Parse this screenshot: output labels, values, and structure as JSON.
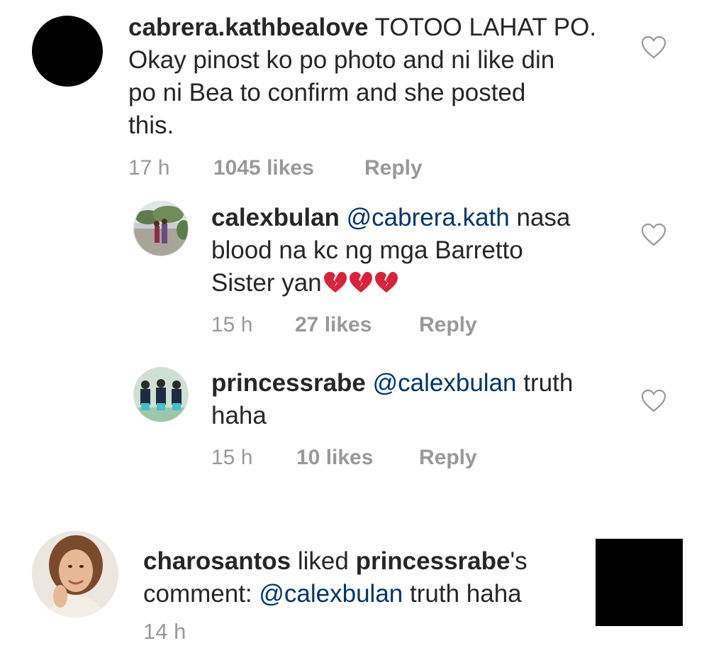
{
  "comments": [
    {
      "username": "cabrera.kathbealove",
      "lines": [
        "TOTOO LAHAT PO.",
        "Okay pinost ko po photo and ni like din",
        "po ni Bea to confirm and she posted",
        "this."
      ],
      "time": "17 h",
      "likes": "1045 likes",
      "reply": "Reply"
    },
    {
      "username": "calexbulan",
      "mention": "@cabrera.kath",
      "lines": [
        "nasa",
        "blood na kc ng mga Barretto",
        "Sister yan"
      ],
      "time": "15 h",
      "likes": "27 likes",
      "reply": "Reply"
    },
    {
      "username": "princessrabe",
      "mention": "@calexbulan",
      "lines": [
        "truth",
        "haha"
      ],
      "time": "15 h",
      "likes": "10 likes",
      "reply": "Reply"
    }
  ],
  "notification": {
    "actor": "charosantos",
    "action": "liked",
    "target_user": "princessrabe",
    "target_suffix": "'s",
    "line2_prefix": "comment:",
    "mention": "@calexbulan",
    "comment_text": "truth haha",
    "time": "14 h"
  },
  "icons": {
    "like": "heart-outline-icon",
    "emoji": "broken-heart-icon"
  },
  "colors": {
    "text": "#262626",
    "meta": "#999999",
    "mention": "#003569"
  }
}
